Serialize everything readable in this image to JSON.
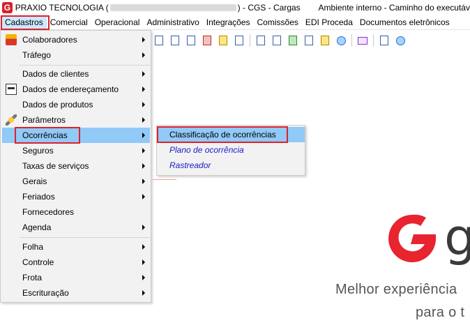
{
  "window": {
    "app_icon_letter": "G",
    "title_prefix": "PRAXIO TECNOLOGIA (",
    "title_suffix": ") - CGS - Cargas",
    "environment_text": "Ambiente interno - Caminho do executáv"
  },
  "menubar": {
    "items": [
      "Cadastros",
      "Comercial",
      "Operacional",
      "Administrativo",
      "Integrações",
      "Comissões",
      "EDI Proceda",
      "Documentos eletrônicos"
    ]
  },
  "cadastros_menu": {
    "items": [
      {
        "label": "Colaboradores",
        "icon": "people-icon",
        "submenu": true
      },
      {
        "label": "Tráfego",
        "submenu": true
      },
      {
        "label": "Dados de clientes",
        "submenu": true
      },
      {
        "label": "Dados de endereçamento",
        "icon": "address-card-icon",
        "submenu": true
      },
      {
        "label": "Dados de produtos",
        "submenu": true
      },
      {
        "label": "Parâmetros",
        "icon": "tools-icon",
        "submenu": true
      },
      {
        "label": "Ocorrências",
        "submenu": true
      },
      {
        "label": "Seguros",
        "submenu": true
      },
      {
        "label": "Taxas de serviços",
        "submenu": true
      },
      {
        "label": "Gerais",
        "submenu": true
      },
      {
        "label": "Feriados",
        "submenu": true
      },
      {
        "label": "Fornecedores",
        "submenu": false
      },
      {
        "label": "Agenda",
        "submenu": true
      },
      {
        "label": "Folha",
        "submenu": true
      },
      {
        "label": "Controle",
        "submenu": true
      },
      {
        "label": "Frota",
        "submenu": true
      },
      {
        "label": "Escrituração",
        "submenu": true
      }
    ]
  },
  "ocorrencias_submenu": {
    "items": [
      "Classificação de ocorrências",
      "Plano de ocorrência",
      "Rastreador"
    ]
  },
  "toolbar": {
    "icons": [
      "document-icon",
      "copy-icon",
      "print-list-icon",
      "truck-icon",
      "clipboard-icon",
      "key-icon",
      "search-doc-icon",
      "report-icon",
      "picture-icon",
      "printer-icon",
      "pie-chart-icon",
      "bell-icon",
      "monitor-icon",
      "tools-icon",
      "brand-icon"
    ]
  },
  "background": {
    "brand_letter": "g",
    "tagline_line1": "Melhor experiência",
    "tagline_line2": "para o t"
  },
  "colors": {
    "highlight_red": "#e0202a",
    "hover_blue": "#91c9f7",
    "brand_red": "#d8202b",
    "link_blue": "#1a1ac8"
  }
}
